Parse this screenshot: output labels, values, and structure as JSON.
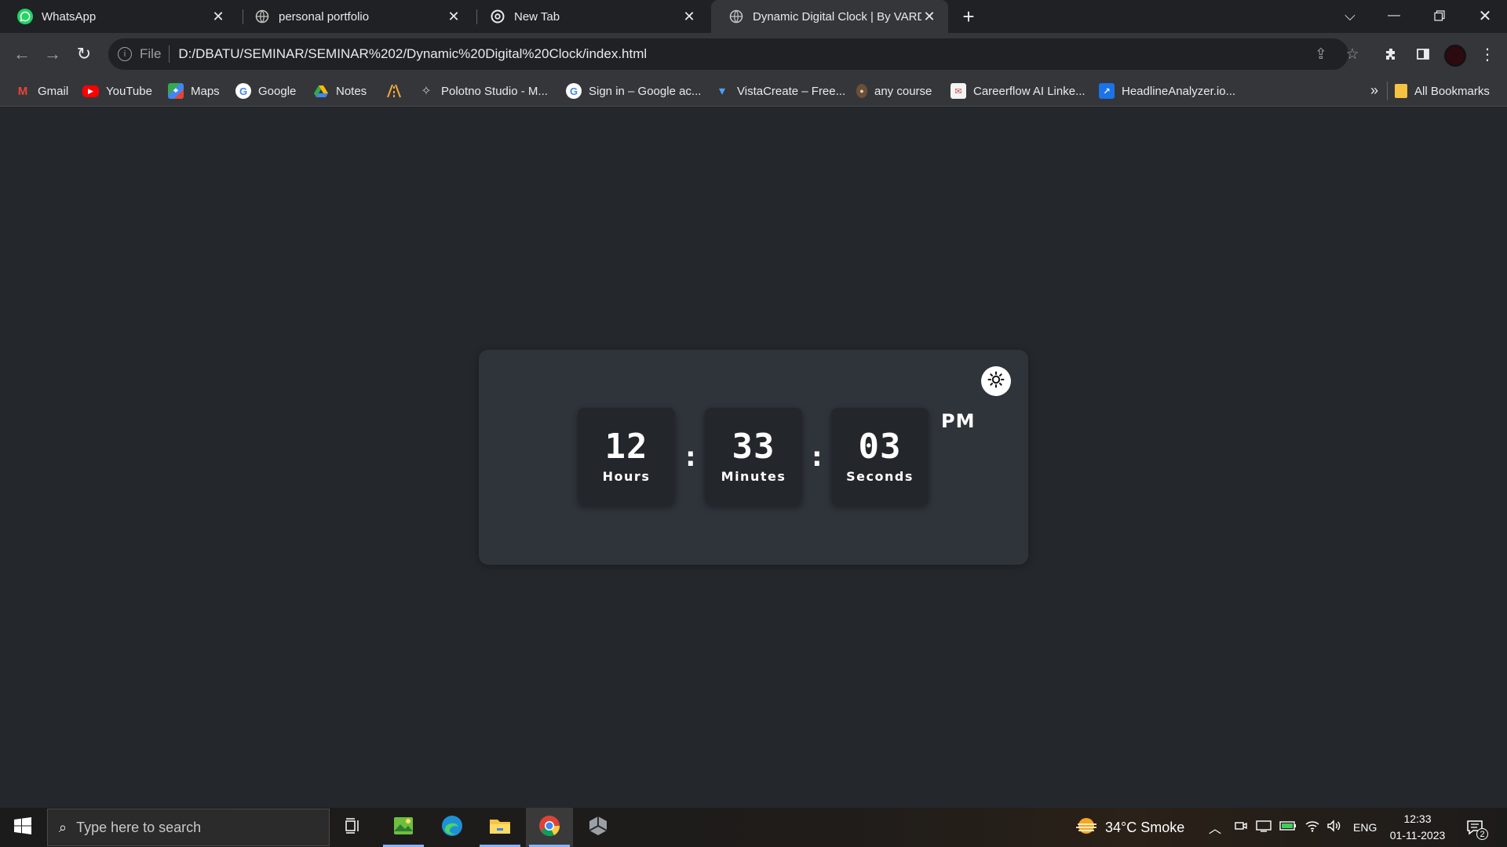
{
  "browser": {
    "tabs": [
      {
        "title": "WhatsApp",
        "icon": "whatsapp-icon",
        "active": false
      },
      {
        "title": "personal portfolio",
        "icon": "globe-icon",
        "active": false
      },
      {
        "title": "New Tab",
        "icon": "chrome-icon",
        "active": false
      },
      {
        "title": "Dynamic Digital Clock | By VARD",
        "icon": "globe-icon",
        "active": true
      }
    ],
    "address_bar": {
      "scheme_label": "File",
      "url": "D:/DBATU/SEMINAR/SEMINAR%202/Dynamic%20Digital%20Clock/index.html"
    },
    "bookmarks": [
      {
        "label": "Gmail",
        "icon": "gmail-icon"
      },
      {
        "label": "YouTube",
        "icon": "youtube-icon"
      },
      {
        "label": "Maps",
        "icon": "maps-icon"
      },
      {
        "label": "Google",
        "icon": "google-icon"
      },
      {
        "label": "Notes",
        "icon": "drive-icon"
      },
      {
        "label": "",
        "icon": "road-icon"
      },
      {
        "label": "Polotno Studio - M...",
        "icon": "polotno-icon"
      },
      {
        "label": "Sign in – Google ac...",
        "icon": "google-icon"
      },
      {
        "label": "VistaCreate – Free...",
        "icon": "vistacreate-icon"
      },
      {
        "label": "any course",
        "icon": "person-icon"
      },
      {
        "label": "Careerflow AI Linke...",
        "icon": "careerflow-icon"
      },
      {
        "label": "HeadlineAnalyzer.io...",
        "icon": "headline-icon"
      }
    ],
    "bookmarks_overflow": "»",
    "all_bookmarks_label": "All Bookmarks"
  },
  "clock": {
    "hours": "12",
    "hours_label": "Hours",
    "minutes": "33",
    "minutes_label": "Minutes",
    "seconds": "03",
    "seconds_label": "Seconds",
    "separator": ":",
    "period": "PM"
  },
  "taskbar": {
    "search_placeholder": "Type here to search",
    "weather": "34°C  Smoke",
    "language": "ENG",
    "time": "12:33",
    "date": "01-11-2023",
    "notification_count": "2"
  },
  "colors": {
    "page_bg": "#24272b",
    "card_bg": "#2f333a",
    "unit_bg": "#23262b",
    "clock_text": "#ffffff"
  }
}
